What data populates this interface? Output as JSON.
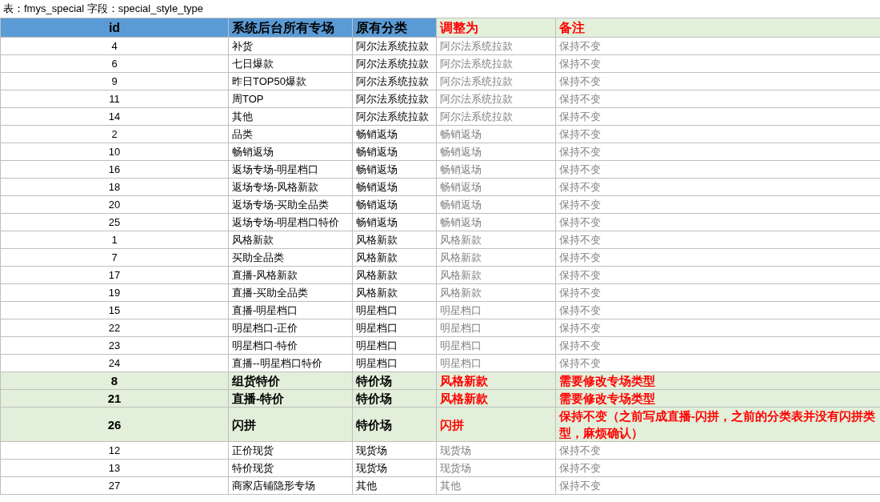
{
  "caption": "表：fmys_special 字段：special_style_type",
  "columns": [
    {
      "label": "id",
      "accent": false
    },
    {
      "label": "系统后台所有专场",
      "accent": false
    },
    {
      "label": "原有分类",
      "accent": false
    },
    {
      "label": "调整为",
      "accent": true
    },
    {
      "label": "备注",
      "accent": true
    }
  ],
  "rows": [
    {
      "id": "4",
      "venue": "补货",
      "original": "阿尔法系统拉款",
      "adjusted": "阿尔法系统拉款",
      "remark": "保持不变",
      "highlighted": false
    },
    {
      "id": "6",
      "venue": "七日爆款",
      "original": "阿尔法系统拉款",
      "adjusted": "阿尔法系统拉款",
      "remark": "保持不变",
      "highlighted": false
    },
    {
      "id": "9",
      "venue": "昨日TOP50爆款",
      "original": "阿尔法系统拉款",
      "adjusted": "阿尔法系统拉款",
      "remark": "保持不变",
      "highlighted": false
    },
    {
      "id": "11",
      "venue": "周TOP",
      "original": "阿尔法系统拉款",
      "adjusted": "阿尔法系统拉款",
      "remark": "保持不变",
      "highlighted": false
    },
    {
      "id": "14",
      "venue": "其他",
      "original": "阿尔法系统拉款",
      "adjusted": "阿尔法系统拉款",
      "remark": "保持不变",
      "highlighted": false
    },
    {
      "id": "2",
      "venue": "品类",
      "original": "畅销返场",
      "adjusted": "畅销返场",
      "remark": "保持不变",
      "highlighted": false
    },
    {
      "id": "10",
      "venue": "畅销返场",
      "original": "畅销返场",
      "adjusted": "畅销返场",
      "remark": "保持不变",
      "highlighted": false
    },
    {
      "id": "16",
      "venue": "返场专场-明星档口",
      "original": "畅销返场",
      "adjusted": "畅销返场",
      "remark": "保持不变",
      "highlighted": false
    },
    {
      "id": "18",
      "venue": "返场专场-风格新款",
      "original": "畅销返场",
      "adjusted": "畅销返场",
      "remark": "保持不变",
      "highlighted": false
    },
    {
      "id": "20",
      "venue": "返场专场-买助全品类",
      "original": "畅销返场",
      "adjusted": "畅销返场",
      "remark": "保持不变",
      "highlighted": false
    },
    {
      "id": "25",
      "venue": "返场专场-明星档口特价",
      "original": "畅销返场",
      "adjusted": "畅销返场",
      "remark": "保持不变",
      "highlighted": false
    },
    {
      "id": "1",
      "venue": "风格新款",
      "original": "风格新款",
      "adjusted": "风格新款",
      "remark": "保持不变",
      "highlighted": false
    },
    {
      "id": "7",
      "venue": "买助全品类",
      "original": "风格新款",
      "adjusted": "风格新款",
      "remark": "保持不变",
      "highlighted": false
    },
    {
      "id": "17",
      "venue": "直播-风格新款",
      "original": "风格新款",
      "adjusted": "风格新款",
      "remark": "保持不变",
      "highlighted": false
    },
    {
      "id": "19",
      "venue": "直播-买助全品类",
      "original": "风格新款",
      "adjusted": "风格新款",
      "remark": "保持不变",
      "highlighted": false
    },
    {
      "id": "15",
      "venue": "直播-明星档口",
      "original": "明星档口",
      "adjusted": "明星档口",
      "remark": "保持不变",
      "highlighted": false
    },
    {
      "id": "22",
      "venue": "明星档口-正价",
      "original": "明星档口",
      "adjusted": "明星档口",
      "remark": "保持不变",
      "highlighted": false
    },
    {
      "id": "23",
      "venue": "明星档口-特价",
      "original": "明星档口",
      "adjusted": "明星档口",
      "remark": "保持不变",
      "highlighted": false
    },
    {
      "id": "24",
      "venue": "直播--明星档口特价",
      "original": "明星档口",
      "adjusted": "明星档口",
      "remark": "保持不变",
      "highlighted": false
    },
    {
      "id": "8",
      "venue": "组货特价",
      "original": "特价场",
      "adjusted": "风格新款",
      "remark": "需要修改专场类型",
      "highlighted": true
    },
    {
      "id": "21",
      "venue": "直播-特价",
      "original": "特价场",
      "adjusted": "风格新款",
      "remark": "需要修改专场类型",
      "highlighted": true
    },
    {
      "id": "26",
      "venue": "闪拼",
      "original": "特价场",
      "adjusted": "闪拼",
      "remark": "保持不变（之前写成直播-闪拼，之前的分类表并没有闪拼类型，麻烦确认）",
      "highlighted": true
    },
    {
      "id": "12",
      "venue": "正价现货",
      "original": "现货场",
      "adjusted": "现货场",
      "remark": "保持不变",
      "highlighted": false
    },
    {
      "id": "13",
      "venue": "特价现货",
      "original": "现货场",
      "adjusted": "现货场",
      "remark": "保持不变",
      "highlighted": false
    },
    {
      "id": "27",
      "venue": "商家店铺隐形专场",
      "original": "其他",
      "adjusted": "其他",
      "remark": "保持不变",
      "highlighted": false
    }
  ]
}
